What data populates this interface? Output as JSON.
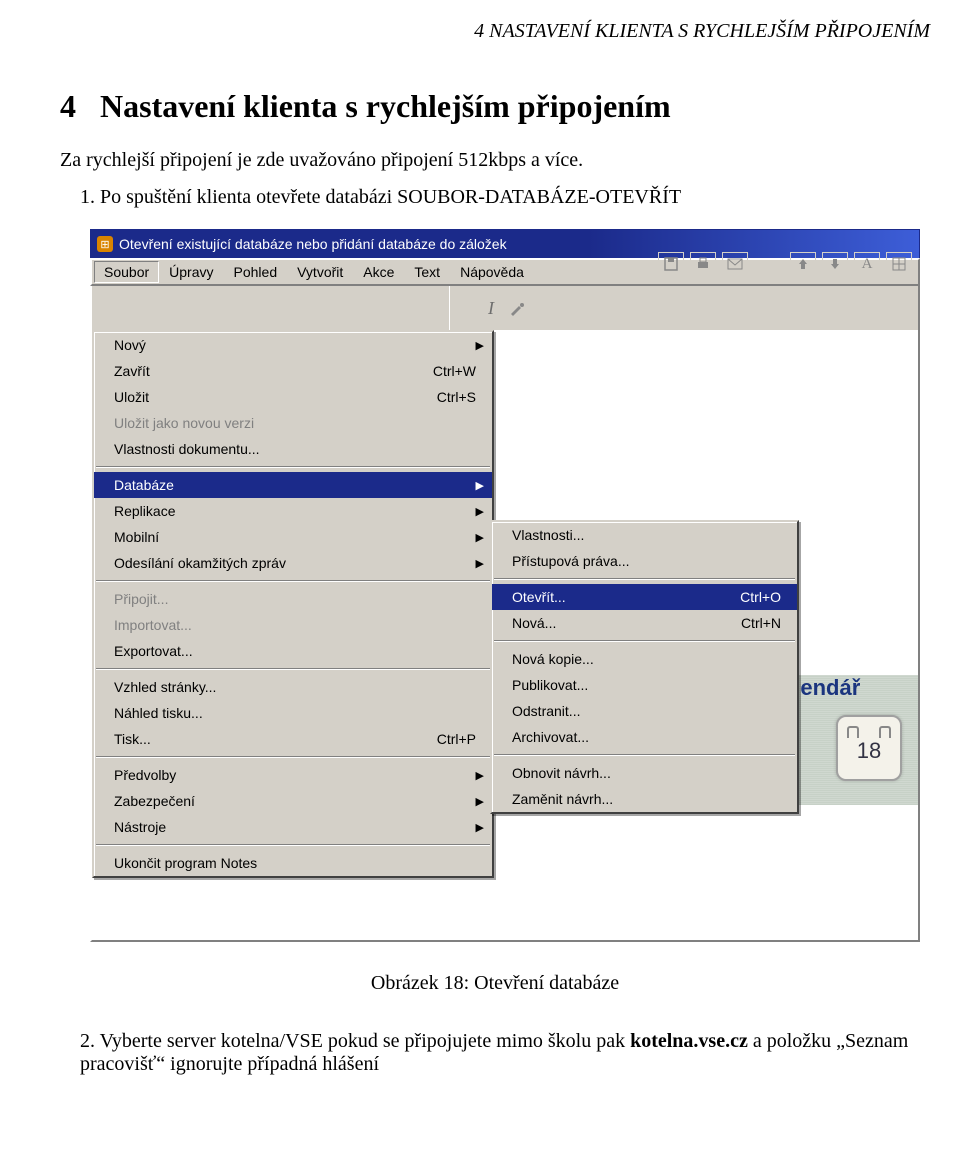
{
  "doc": {
    "running_header": "4  NASTAVENÍ KLIENTA S RYCHLEJŠÍM PŘIPOJENÍM",
    "section_num": "4",
    "section_title": "Nastavení klienta s rychlejším připojením",
    "intro": "Za rychlejší připojení je zde uvažováno připojení 512kbps a více.",
    "step1": "1. Po spuštění klienta otevřete databázi SOUBOR-DATABÁZE-OTEVŘÍT",
    "caption": "Obrázek 18: Otevření databáze",
    "step2_a": "2. Vyberte server kotelna/VSE pokud se připojujete mimo školu pak ",
    "step2_b": "kotelna.vse.cz",
    "step2_c": " a položku „Seznam pracovišť“ ignorujte případná hlášení"
  },
  "app": {
    "title": "Otevření existující databáze nebo přidání databáze do záložek",
    "menubar": [
      "Soubor",
      "Úpravy",
      "Pohled",
      "Vytvořit",
      "Akce",
      "Text",
      "Nápověda"
    ],
    "menu1": [
      {
        "label": "Nový",
        "type": "sub"
      },
      {
        "label": "Zavřít",
        "shortcut": "Ctrl+W"
      },
      {
        "label": "Uložit",
        "shortcut": "Ctrl+S"
      },
      {
        "label": "Uložit jako novou verzi",
        "disabled": true
      },
      {
        "label": "Vlastnosti dokumentu..."
      },
      {
        "sep": true
      },
      {
        "label": "Databáze",
        "type": "sub",
        "hover": true
      },
      {
        "label": "Replikace",
        "type": "sub"
      },
      {
        "label": "Mobilní",
        "type": "sub"
      },
      {
        "label": "Odesílání okamžitých zpráv",
        "type": "sub"
      },
      {
        "sep": true
      },
      {
        "label": "Připojit...",
        "disabled": true
      },
      {
        "label": "Importovat...",
        "disabled": true
      },
      {
        "label": "Exportovat..."
      },
      {
        "sep": true
      },
      {
        "label": "Vzhled stránky..."
      },
      {
        "label": "Náhled tisku..."
      },
      {
        "label": "Tisk...",
        "shortcut": "Ctrl+P"
      },
      {
        "sep": true
      },
      {
        "label": "Předvolby",
        "type": "sub"
      },
      {
        "label": "Zabezpečení",
        "type": "sub"
      },
      {
        "label": "Nástroje",
        "type": "sub"
      },
      {
        "sep": true
      },
      {
        "label": "Ukončit program Notes"
      }
    ],
    "menu2": [
      {
        "label": "Vlastnosti..."
      },
      {
        "label": "Přístupová práva..."
      },
      {
        "sep": true
      },
      {
        "label": "Otevřít...",
        "shortcut": "Ctrl+O",
        "hover": true
      },
      {
        "label": "Nová...",
        "shortcut": "Ctrl+N"
      },
      {
        "sep": true
      },
      {
        "label": "Nová kopie..."
      },
      {
        "label": "Publikovat..."
      },
      {
        "label": "Odstranit..."
      },
      {
        "label": "Archivovat..."
      },
      {
        "sep": true
      },
      {
        "label": "Obnovit návrh..."
      },
      {
        "label": "Zaměnit návrh..."
      }
    ],
    "content": {
      "kalendar_label": "alendář",
      "cal_day": "18"
    }
  }
}
